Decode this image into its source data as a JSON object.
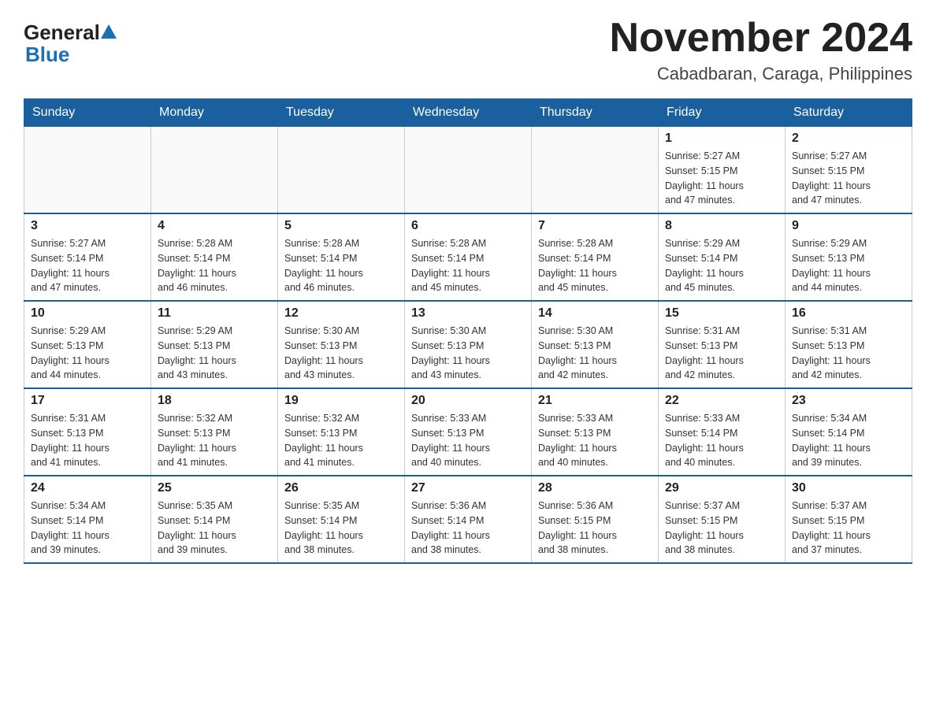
{
  "header": {
    "logo_line1": "General",
    "logo_line2": "Blue",
    "title": "November 2024",
    "subtitle": "Cabadbaran, Caraga, Philippines"
  },
  "calendar": {
    "days_of_week": [
      "Sunday",
      "Monday",
      "Tuesday",
      "Wednesday",
      "Thursday",
      "Friday",
      "Saturday"
    ],
    "weeks": [
      [
        {
          "date": "",
          "info": ""
        },
        {
          "date": "",
          "info": ""
        },
        {
          "date": "",
          "info": ""
        },
        {
          "date": "",
          "info": ""
        },
        {
          "date": "",
          "info": ""
        },
        {
          "date": "1",
          "info": "Sunrise: 5:27 AM\nSunset: 5:15 PM\nDaylight: 11 hours\nand 47 minutes."
        },
        {
          "date": "2",
          "info": "Sunrise: 5:27 AM\nSunset: 5:15 PM\nDaylight: 11 hours\nand 47 minutes."
        }
      ],
      [
        {
          "date": "3",
          "info": "Sunrise: 5:27 AM\nSunset: 5:14 PM\nDaylight: 11 hours\nand 47 minutes."
        },
        {
          "date": "4",
          "info": "Sunrise: 5:28 AM\nSunset: 5:14 PM\nDaylight: 11 hours\nand 46 minutes."
        },
        {
          "date": "5",
          "info": "Sunrise: 5:28 AM\nSunset: 5:14 PM\nDaylight: 11 hours\nand 46 minutes."
        },
        {
          "date": "6",
          "info": "Sunrise: 5:28 AM\nSunset: 5:14 PM\nDaylight: 11 hours\nand 45 minutes."
        },
        {
          "date": "7",
          "info": "Sunrise: 5:28 AM\nSunset: 5:14 PM\nDaylight: 11 hours\nand 45 minutes."
        },
        {
          "date": "8",
          "info": "Sunrise: 5:29 AM\nSunset: 5:14 PM\nDaylight: 11 hours\nand 45 minutes."
        },
        {
          "date": "9",
          "info": "Sunrise: 5:29 AM\nSunset: 5:13 PM\nDaylight: 11 hours\nand 44 minutes."
        }
      ],
      [
        {
          "date": "10",
          "info": "Sunrise: 5:29 AM\nSunset: 5:13 PM\nDaylight: 11 hours\nand 44 minutes."
        },
        {
          "date": "11",
          "info": "Sunrise: 5:29 AM\nSunset: 5:13 PM\nDaylight: 11 hours\nand 43 minutes."
        },
        {
          "date": "12",
          "info": "Sunrise: 5:30 AM\nSunset: 5:13 PM\nDaylight: 11 hours\nand 43 minutes."
        },
        {
          "date": "13",
          "info": "Sunrise: 5:30 AM\nSunset: 5:13 PM\nDaylight: 11 hours\nand 43 minutes."
        },
        {
          "date": "14",
          "info": "Sunrise: 5:30 AM\nSunset: 5:13 PM\nDaylight: 11 hours\nand 42 minutes."
        },
        {
          "date": "15",
          "info": "Sunrise: 5:31 AM\nSunset: 5:13 PM\nDaylight: 11 hours\nand 42 minutes."
        },
        {
          "date": "16",
          "info": "Sunrise: 5:31 AM\nSunset: 5:13 PM\nDaylight: 11 hours\nand 42 minutes."
        }
      ],
      [
        {
          "date": "17",
          "info": "Sunrise: 5:31 AM\nSunset: 5:13 PM\nDaylight: 11 hours\nand 41 minutes."
        },
        {
          "date": "18",
          "info": "Sunrise: 5:32 AM\nSunset: 5:13 PM\nDaylight: 11 hours\nand 41 minutes."
        },
        {
          "date": "19",
          "info": "Sunrise: 5:32 AM\nSunset: 5:13 PM\nDaylight: 11 hours\nand 41 minutes."
        },
        {
          "date": "20",
          "info": "Sunrise: 5:33 AM\nSunset: 5:13 PM\nDaylight: 11 hours\nand 40 minutes."
        },
        {
          "date": "21",
          "info": "Sunrise: 5:33 AM\nSunset: 5:13 PM\nDaylight: 11 hours\nand 40 minutes."
        },
        {
          "date": "22",
          "info": "Sunrise: 5:33 AM\nSunset: 5:14 PM\nDaylight: 11 hours\nand 40 minutes."
        },
        {
          "date": "23",
          "info": "Sunrise: 5:34 AM\nSunset: 5:14 PM\nDaylight: 11 hours\nand 39 minutes."
        }
      ],
      [
        {
          "date": "24",
          "info": "Sunrise: 5:34 AM\nSunset: 5:14 PM\nDaylight: 11 hours\nand 39 minutes."
        },
        {
          "date": "25",
          "info": "Sunrise: 5:35 AM\nSunset: 5:14 PM\nDaylight: 11 hours\nand 39 minutes."
        },
        {
          "date": "26",
          "info": "Sunrise: 5:35 AM\nSunset: 5:14 PM\nDaylight: 11 hours\nand 38 minutes."
        },
        {
          "date": "27",
          "info": "Sunrise: 5:36 AM\nSunset: 5:14 PM\nDaylight: 11 hours\nand 38 minutes."
        },
        {
          "date": "28",
          "info": "Sunrise: 5:36 AM\nSunset: 5:15 PM\nDaylight: 11 hours\nand 38 minutes."
        },
        {
          "date": "29",
          "info": "Sunrise: 5:37 AM\nSunset: 5:15 PM\nDaylight: 11 hours\nand 38 minutes."
        },
        {
          "date": "30",
          "info": "Sunrise: 5:37 AM\nSunset: 5:15 PM\nDaylight: 11 hours\nand 37 minutes."
        }
      ]
    ]
  }
}
